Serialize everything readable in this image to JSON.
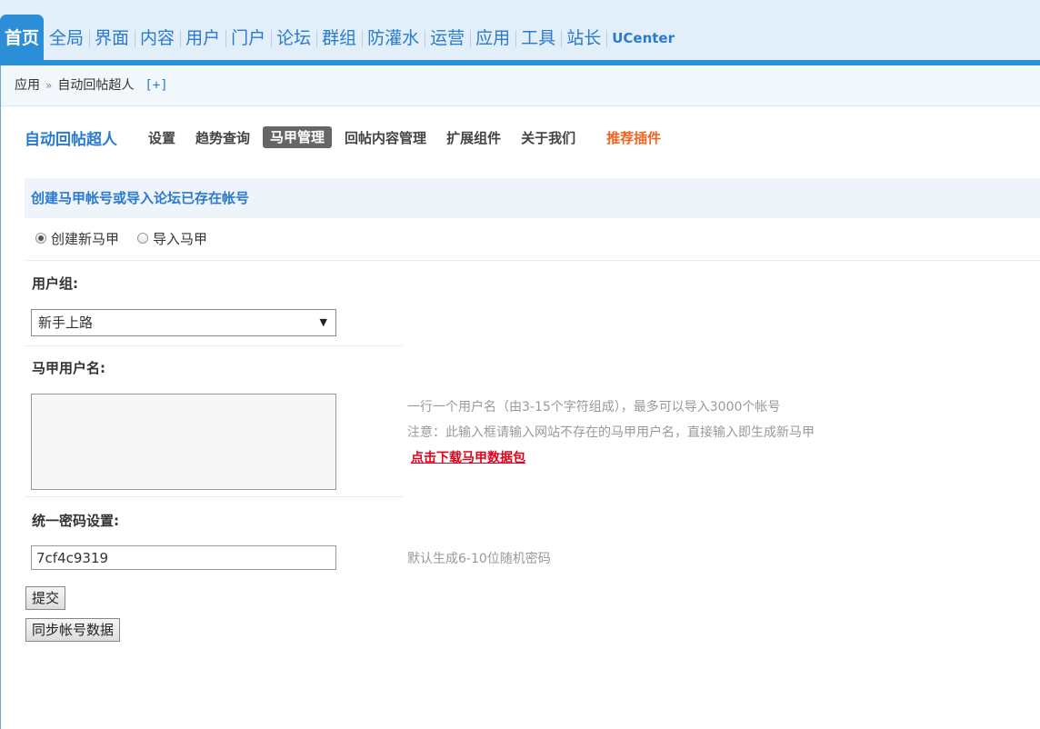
{
  "topnav": {
    "tabs": [
      "首页",
      "全局",
      "界面",
      "内容",
      "用户",
      "门户",
      "论坛",
      "群组",
      "防灌水",
      "运营",
      "应用",
      "工具",
      "站长",
      "UCenter"
    ],
    "active_index": 0
  },
  "breadcrumb": {
    "root": "应用",
    "separator": "»",
    "current": "自动回帖超人",
    "add": "[+]"
  },
  "plugin_menu": {
    "title": "自动回帖超人",
    "items": [
      "设置",
      "趋势查询",
      "马甲管理",
      "回帖内容管理",
      "扩展组件",
      "关于我们"
    ],
    "active": "马甲管理",
    "recommend": "推荐插件"
  },
  "form": {
    "section_title": "创建马甲帐号或导入论坛已存在帐号",
    "mode_options": [
      "创建新马甲",
      "导入马甲"
    ],
    "mode_selected": "创建新马甲",
    "usergroup_label": "用户组:",
    "usergroup_value": "新手上路",
    "usernames_label": "马甲用户名:",
    "usernames_value": "",
    "usernames_hint_1": "一行一个用户名（由3-15个字符组成），最多可以导入3000个帐号",
    "usernames_hint_2": "注意：此输入框请输入网站不存在的马甲用户名，直接输入即生成新马甲",
    "download_link": "点击下载马甲数据包",
    "password_label": "统一密码设置:",
    "password_value": "7cf4c9319",
    "password_hint": "默认生成6-10位随机密码",
    "submit_label": "提交",
    "sync_label": "同步帐号数据"
  },
  "colors": {
    "accent": "#2b8ed6",
    "link": "#2a7ad0",
    "recommend": "#f5641e",
    "danger_link": "#e2001a"
  }
}
